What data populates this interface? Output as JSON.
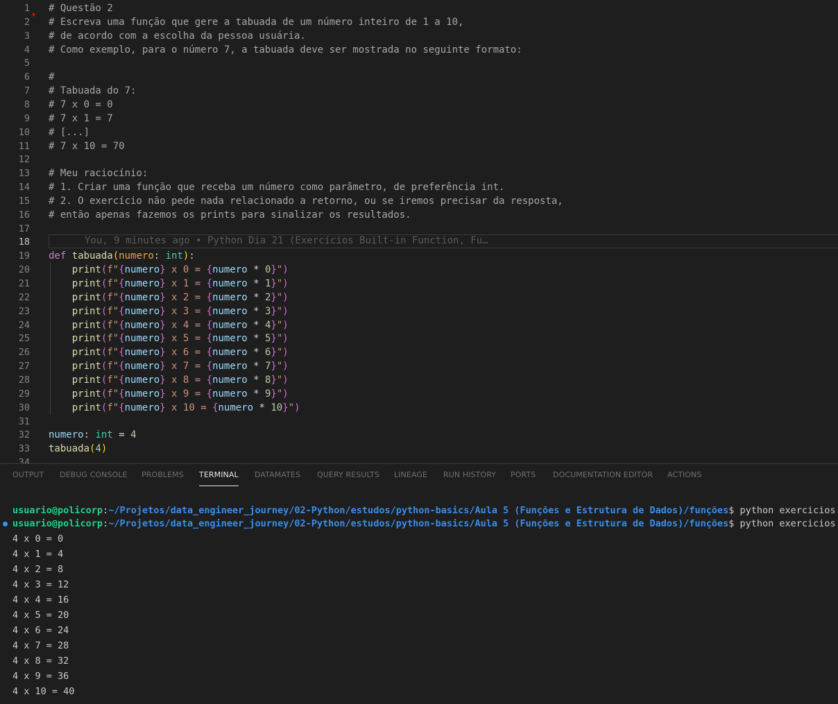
{
  "editor": {
    "active_line": 18,
    "lines": [
      {
        "n": "1",
        "segs": [
          [
            "c-com",
            "# Questão 2"
          ]
        ]
      },
      {
        "n": "2",
        "segs": [
          [
            "c-com",
            "# Escreva uma função que gere a tabuada de um número inteiro de 1 a 10,"
          ]
        ]
      },
      {
        "n": "3",
        "segs": [
          [
            "c-com",
            "# de acordo com a escolha da pessoa usuária."
          ]
        ]
      },
      {
        "n": "4",
        "segs": [
          [
            "c-com",
            "# Como exemplo, para o número 7, a tabuada deve ser mostrada no seguinte formato:"
          ]
        ]
      },
      {
        "n": "5",
        "segs": []
      },
      {
        "n": "6",
        "segs": [
          [
            "c-com",
            "#"
          ]
        ]
      },
      {
        "n": "7",
        "segs": [
          [
            "c-com",
            "# Tabuada do 7:"
          ]
        ]
      },
      {
        "n": "8",
        "segs": [
          [
            "c-com",
            "# 7 x 0 = 0"
          ]
        ]
      },
      {
        "n": "9",
        "segs": [
          [
            "c-com",
            "# 7 x 1 = 7"
          ]
        ]
      },
      {
        "n": "10",
        "segs": [
          [
            "c-com",
            "# [...]"
          ]
        ]
      },
      {
        "n": "11",
        "segs": [
          [
            "c-com",
            "# 7 x 10 = 70"
          ]
        ]
      },
      {
        "n": "12",
        "segs": []
      },
      {
        "n": "13",
        "segs": [
          [
            "c-com",
            "# Meu raciocínio:"
          ]
        ]
      },
      {
        "n": "14",
        "segs": [
          [
            "c-com",
            "# 1. Criar uma função que receba um número como parâmetro, de preferência int."
          ]
        ]
      },
      {
        "n": "15",
        "segs": [
          [
            "c-com",
            "# 2. O exercício não pede nada relacionado a retorno, ou se iremos precisar da resposta,"
          ]
        ]
      },
      {
        "n": "16",
        "segs": [
          [
            "c-com",
            "# então apenas fazemos os prints para sinalizar os resultados."
          ]
        ]
      },
      {
        "n": "17",
        "segs": []
      },
      {
        "n": "18",
        "segs": []
      },
      {
        "n": "19",
        "segs": [
          [
            "c-kw",
            "def "
          ],
          [
            "c-fn",
            "tabuada"
          ],
          [
            "c-brd",
            "("
          ],
          [
            "c-par",
            "numero"
          ],
          [
            "c-op",
            ": "
          ],
          [
            "c-type",
            "int"
          ],
          [
            "c-brd",
            ")"
          ],
          [
            "c-op",
            ":"
          ]
        ]
      },
      {
        "n": "20",
        "segs": [
          [
            "c-op",
            "    "
          ],
          [
            "c-fn",
            "print"
          ],
          [
            "c-br",
            "("
          ],
          [
            "c-str",
            "f\""
          ],
          [
            "c-br",
            "{"
          ],
          [
            "c-var",
            "numero"
          ],
          [
            "c-br",
            "}"
          ],
          [
            "c-str",
            " x 0 = "
          ],
          [
            "c-br",
            "{"
          ],
          [
            "c-var",
            "numero"
          ],
          [
            "c-op",
            " * "
          ],
          [
            "c-num",
            "0"
          ],
          [
            "c-br",
            "}"
          ],
          [
            "c-str",
            "\""
          ],
          [
            "c-br",
            ")"
          ]
        ]
      },
      {
        "n": "21",
        "segs": [
          [
            "c-op",
            "    "
          ],
          [
            "c-fn",
            "print"
          ],
          [
            "c-br",
            "("
          ],
          [
            "c-str",
            "f\""
          ],
          [
            "c-br",
            "{"
          ],
          [
            "c-var",
            "numero"
          ],
          [
            "c-br",
            "}"
          ],
          [
            "c-str",
            " x 1 = "
          ],
          [
            "c-br",
            "{"
          ],
          [
            "c-var",
            "numero"
          ],
          [
            "c-op",
            " * "
          ],
          [
            "c-num",
            "1"
          ],
          [
            "c-br",
            "}"
          ],
          [
            "c-str",
            "\""
          ],
          [
            "c-br",
            ")"
          ]
        ]
      },
      {
        "n": "22",
        "segs": [
          [
            "c-op",
            "    "
          ],
          [
            "c-fn",
            "print"
          ],
          [
            "c-br",
            "("
          ],
          [
            "c-str",
            "f\""
          ],
          [
            "c-br",
            "{"
          ],
          [
            "c-var",
            "numero"
          ],
          [
            "c-br",
            "}"
          ],
          [
            "c-str",
            " x 2 = "
          ],
          [
            "c-br",
            "{"
          ],
          [
            "c-var",
            "numero"
          ],
          [
            "c-op",
            " * "
          ],
          [
            "c-num",
            "2"
          ],
          [
            "c-br",
            "}"
          ],
          [
            "c-str",
            "\""
          ],
          [
            "c-br",
            ")"
          ]
        ]
      },
      {
        "n": "23",
        "segs": [
          [
            "c-op",
            "    "
          ],
          [
            "c-fn",
            "print"
          ],
          [
            "c-br",
            "("
          ],
          [
            "c-str",
            "f\""
          ],
          [
            "c-br",
            "{"
          ],
          [
            "c-var",
            "numero"
          ],
          [
            "c-br",
            "}"
          ],
          [
            "c-str",
            " x 3 = "
          ],
          [
            "c-br",
            "{"
          ],
          [
            "c-var",
            "numero"
          ],
          [
            "c-op",
            " * "
          ],
          [
            "c-num",
            "3"
          ],
          [
            "c-br",
            "}"
          ],
          [
            "c-str",
            "\""
          ],
          [
            "c-br",
            ")"
          ]
        ]
      },
      {
        "n": "24",
        "segs": [
          [
            "c-op",
            "    "
          ],
          [
            "c-fn",
            "print"
          ],
          [
            "c-br",
            "("
          ],
          [
            "c-str",
            "f\""
          ],
          [
            "c-br",
            "{"
          ],
          [
            "c-var",
            "numero"
          ],
          [
            "c-br",
            "}"
          ],
          [
            "c-str",
            " x 4 = "
          ],
          [
            "c-br",
            "{"
          ],
          [
            "c-var",
            "numero"
          ],
          [
            "c-op",
            " * "
          ],
          [
            "c-num",
            "4"
          ],
          [
            "c-br",
            "}"
          ],
          [
            "c-str",
            "\""
          ],
          [
            "c-br",
            ")"
          ]
        ]
      },
      {
        "n": "25",
        "segs": [
          [
            "c-op",
            "    "
          ],
          [
            "c-fn",
            "print"
          ],
          [
            "c-br",
            "("
          ],
          [
            "c-str",
            "f\""
          ],
          [
            "c-br",
            "{"
          ],
          [
            "c-var",
            "numero"
          ],
          [
            "c-br",
            "}"
          ],
          [
            "c-str",
            " x 5 = "
          ],
          [
            "c-br",
            "{"
          ],
          [
            "c-var",
            "numero"
          ],
          [
            "c-op",
            " * "
          ],
          [
            "c-num",
            "5"
          ],
          [
            "c-br",
            "}"
          ],
          [
            "c-str",
            "\""
          ],
          [
            "c-br",
            ")"
          ]
        ]
      },
      {
        "n": "26",
        "segs": [
          [
            "c-op",
            "    "
          ],
          [
            "c-fn",
            "print"
          ],
          [
            "c-br",
            "("
          ],
          [
            "c-str",
            "f\""
          ],
          [
            "c-br",
            "{"
          ],
          [
            "c-var",
            "numero"
          ],
          [
            "c-br",
            "}"
          ],
          [
            "c-str",
            " x 6 = "
          ],
          [
            "c-br",
            "{"
          ],
          [
            "c-var",
            "numero"
          ],
          [
            "c-op",
            " * "
          ],
          [
            "c-num",
            "6"
          ],
          [
            "c-br",
            "}"
          ],
          [
            "c-str",
            "\""
          ],
          [
            "c-br",
            ")"
          ]
        ]
      },
      {
        "n": "27",
        "segs": [
          [
            "c-op",
            "    "
          ],
          [
            "c-fn",
            "print"
          ],
          [
            "c-br",
            "("
          ],
          [
            "c-str",
            "f\""
          ],
          [
            "c-br",
            "{"
          ],
          [
            "c-var",
            "numero"
          ],
          [
            "c-br",
            "}"
          ],
          [
            "c-str",
            " x 7 = "
          ],
          [
            "c-br",
            "{"
          ],
          [
            "c-var",
            "numero"
          ],
          [
            "c-op",
            " * "
          ],
          [
            "c-num",
            "7"
          ],
          [
            "c-br",
            "}"
          ],
          [
            "c-str",
            "\""
          ],
          [
            "c-br",
            ")"
          ]
        ]
      },
      {
        "n": "28",
        "segs": [
          [
            "c-op",
            "    "
          ],
          [
            "c-fn",
            "print"
          ],
          [
            "c-br",
            "("
          ],
          [
            "c-str",
            "f\""
          ],
          [
            "c-br",
            "{"
          ],
          [
            "c-var",
            "numero"
          ],
          [
            "c-br",
            "}"
          ],
          [
            "c-str",
            " x 8 = "
          ],
          [
            "c-br",
            "{"
          ],
          [
            "c-var",
            "numero"
          ],
          [
            "c-op",
            " * "
          ],
          [
            "c-num",
            "8"
          ],
          [
            "c-br",
            "}"
          ],
          [
            "c-str",
            "\""
          ],
          [
            "c-br",
            ")"
          ]
        ]
      },
      {
        "n": "29",
        "segs": [
          [
            "c-op",
            "    "
          ],
          [
            "c-fn",
            "print"
          ],
          [
            "c-br",
            "("
          ],
          [
            "c-str",
            "f\""
          ],
          [
            "c-br",
            "{"
          ],
          [
            "c-var",
            "numero"
          ],
          [
            "c-br",
            "}"
          ],
          [
            "c-str",
            " x 9 = "
          ],
          [
            "c-br",
            "{"
          ],
          [
            "c-var",
            "numero"
          ],
          [
            "c-op",
            " * "
          ],
          [
            "c-num",
            "9"
          ],
          [
            "c-br",
            "}"
          ],
          [
            "c-str",
            "\""
          ],
          [
            "c-br",
            ")"
          ]
        ]
      },
      {
        "n": "30",
        "segs": [
          [
            "c-op",
            "    "
          ],
          [
            "c-fn",
            "print"
          ],
          [
            "c-br",
            "("
          ],
          [
            "c-str",
            "f\""
          ],
          [
            "c-br",
            "{"
          ],
          [
            "c-var",
            "numero"
          ],
          [
            "c-br",
            "}"
          ],
          [
            "c-str",
            " x 10 = "
          ],
          [
            "c-br",
            "{"
          ],
          [
            "c-var",
            "numero"
          ],
          [
            "c-op",
            " * "
          ],
          [
            "c-num",
            "10"
          ],
          [
            "c-br",
            "}"
          ],
          [
            "c-str",
            "\""
          ],
          [
            "c-br",
            ")"
          ]
        ]
      },
      {
        "n": "31",
        "segs": []
      },
      {
        "n": "32",
        "segs": [
          [
            "c-var",
            "numero"
          ],
          [
            "c-op",
            ": "
          ],
          [
            "c-type",
            "int"
          ],
          [
            "c-op",
            " = "
          ],
          [
            "c-num",
            "4"
          ]
        ]
      },
      {
        "n": "33",
        "segs": [
          [
            "c-fn",
            "tabuada"
          ],
          [
            "c-brd",
            "("
          ],
          [
            "c-num",
            "4"
          ],
          [
            "c-brd",
            ")"
          ]
        ]
      },
      {
        "n": "34",
        "segs": []
      }
    ],
    "blame_text": "You, 9 minutes ago • Python Dia 21 (Exercícios Built-in Function, Fu…"
  },
  "panel": {
    "tabs": [
      {
        "label": "OUTPUT",
        "active": false
      },
      {
        "label": "DEBUG CONSOLE",
        "active": false
      },
      {
        "label": "PROBLEMS",
        "active": false
      },
      {
        "label": "TERMINAL",
        "active": true
      },
      {
        "label": "DATAMATES",
        "active": false
      },
      {
        "label": "QUERY RESULTS",
        "active": false
      },
      {
        "label": "LINEAGE",
        "active": false
      },
      {
        "label": "RUN HISTORY",
        "active": false
      },
      {
        "label": "PORTS",
        "active": false
      },
      {
        "label": "DOCUMENTATION EDITOR",
        "active": false
      },
      {
        "label": "ACTIONS",
        "active": false
      }
    ]
  },
  "terminal": {
    "user": "usuario@policorp",
    "path": "~/Projetos/data_engineer_journey/02-Python/estudos/python-basics/Aula 5 (Funções e Estrutura de Dados)/funções",
    "command": "$ python exercicios.py",
    "output": [
      "4 x 0 = 0",
      "4 x 1 = 4",
      "4 x 2 = 8",
      "4 x 3 = 12",
      "4 x 4 = 16",
      "4 x 5 = 20",
      "4 x 6 = 24",
      "4 x 7 = 28",
      "4 x 8 = 32",
      "4 x 9 = 36",
      "4 x 10 = 40"
    ]
  },
  "colors": {
    "background": "#1e1e1e",
    "terminal_user": "#23d18b",
    "terminal_path": "#3b8eea",
    "active_tab": "#e7e7e7"
  }
}
